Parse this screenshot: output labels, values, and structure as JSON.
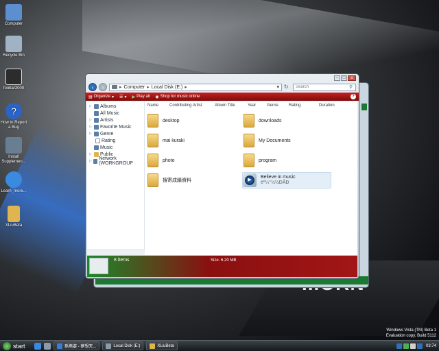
{
  "desktop": {
    "icons": [
      {
        "label": "Computer",
        "icon": "computer-icon",
        "color": "#5b8fd0"
      },
      {
        "label": "Recycle Bin",
        "icon": "recycle-bin-icon",
        "color": "#9fb3c4"
      },
      {
        "label": "foobar2000",
        "icon": "foobar2000-icon",
        "color": "#2c2c2c"
      },
      {
        "label": "How to Report a Bug",
        "icon": "help-icon",
        "color": "#2a64c8"
      },
      {
        "label": "Install Supplemen...",
        "icon": "install-icon",
        "color": "#6a7e92"
      },
      {
        "label": "Learn_more...",
        "icon": "ie-icon",
        "color": "#3a8ae0"
      },
      {
        "label": "XLiuBeta",
        "icon": "folder-icon",
        "color": "#e0b44e"
      }
    ],
    "brand_text": "...ORN"
  },
  "explorer": {
    "address": {
      "parts": [
        "Computer",
        "Local Disk (E:)"
      ]
    },
    "search_placeholder": "Search",
    "toolbar": {
      "organize": "Organize",
      "play_all": "Play all",
      "shop": "Shop for music online"
    },
    "nav_items": [
      {
        "label": "Albums",
        "indent": false
      },
      {
        "label": "All Music",
        "indent": false
      },
      {
        "label": "Artists",
        "indent": false
      },
      {
        "label": "Favorite Music",
        "indent": false
      },
      {
        "label": "Genre",
        "indent": false
      },
      {
        "label": "Rating",
        "indent": true
      },
      {
        "label": "Music",
        "indent": false
      },
      {
        "label": "Public",
        "indent": false
      },
      {
        "label": "Network (WORKGROUP",
        "indent": false
      }
    ],
    "columns": [
      "Name",
      "Contributing Artist",
      "Album Title",
      "Year",
      "Genre",
      "Rating",
      "Duration"
    ],
    "items": [
      {
        "name": "desktop",
        "type": "folder"
      },
      {
        "name": "downloads",
        "type": "folder"
      },
      {
        "name": "mai kuraki",
        "type": "folder"
      },
      {
        "name": "My Documents",
        "type": "folder"
      },
      {
        "name": "photo",
        "type": "folder"
      },
      {
        "name": "program",
        "type": "folder"
      },
      {
        "name": "搜寄成績資料",
        "type": "folder"
      },
      {
        "name": "Believe in music",
        "sub": "ëº¼°½½ÐÂÐ",
        "type": "media"
      }
    ],
    "details": {
      "count": "8 items",
      "size": "Size: 6.20 MB"
    }
  },
  "taskbar": {
    "start": "start",
    "tasks": [
      {
        "label": "孫燕姿 - 夢想天...",
        "icon": "media-player-icon",
        "color": "#3a7bd5"
      },
      {
        "label": "Local Disk (E:)",
        "icon": "drive-icon",
        "color": "#8a9aa8"
      },
      {
        "label": "XLiuBeta",
        "icon": "folder-icon",
        "color": "#e0b44e"
      }
    ],
    "clock": "03:74"
  },
  "watermark": {
    "line1": "Windows Vista (TM) Beta 1",
    "line2": "Evaluation copy. Build 5112"
  }
}
